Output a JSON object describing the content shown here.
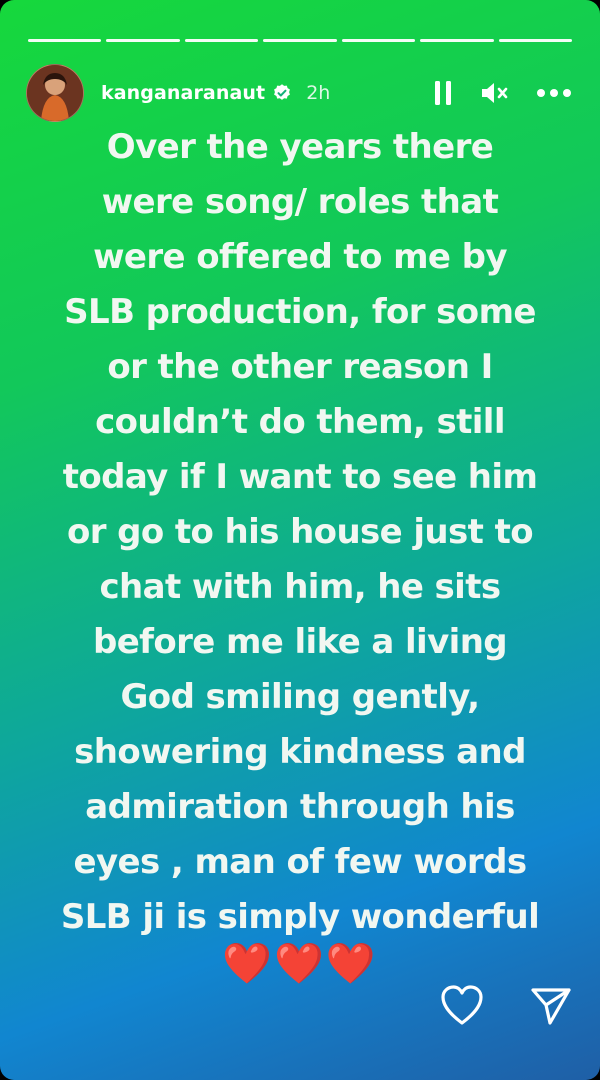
{
  "story": {
    "segment_count": 7,
    "segments_viewed": 7,
    "user": {
      "username": "kanganaranaut",
      "verified": true,
      "time": "2h"
    },
    "controls": {
      "pause_icon": "pause-icon",
      "mute_icon": "speaker-muted-icon",
      "more_icon": "more-options-icon"
    },
    "text": "Over the years there\nwere song/ roles that\nwere offered to me by\nSLB production, for some\nor the other reason I\ncouldn’t do them, still\ntoday if I want to see him\nor go to his house just to\nchat with him, he sits\nbefore me like a living\nGod smiling gently,\nshowering kindness and\nadmiration through his\neyes , man of few words\nSLB ji is simply wonderful",
    "hearts": "❤️❤️❤️",
    "actions": {
      "like_icon": "heart-outline-icon",
      "share_icon": "send-icon"
    },
    "colors": {
      "gradient_top": "#16d83c",
      "gradient_mid": "#0ea79c",
      "gradient_bottom": "#1f5fa6",
      "text": "#f1f7f1"
    }
  }
}
